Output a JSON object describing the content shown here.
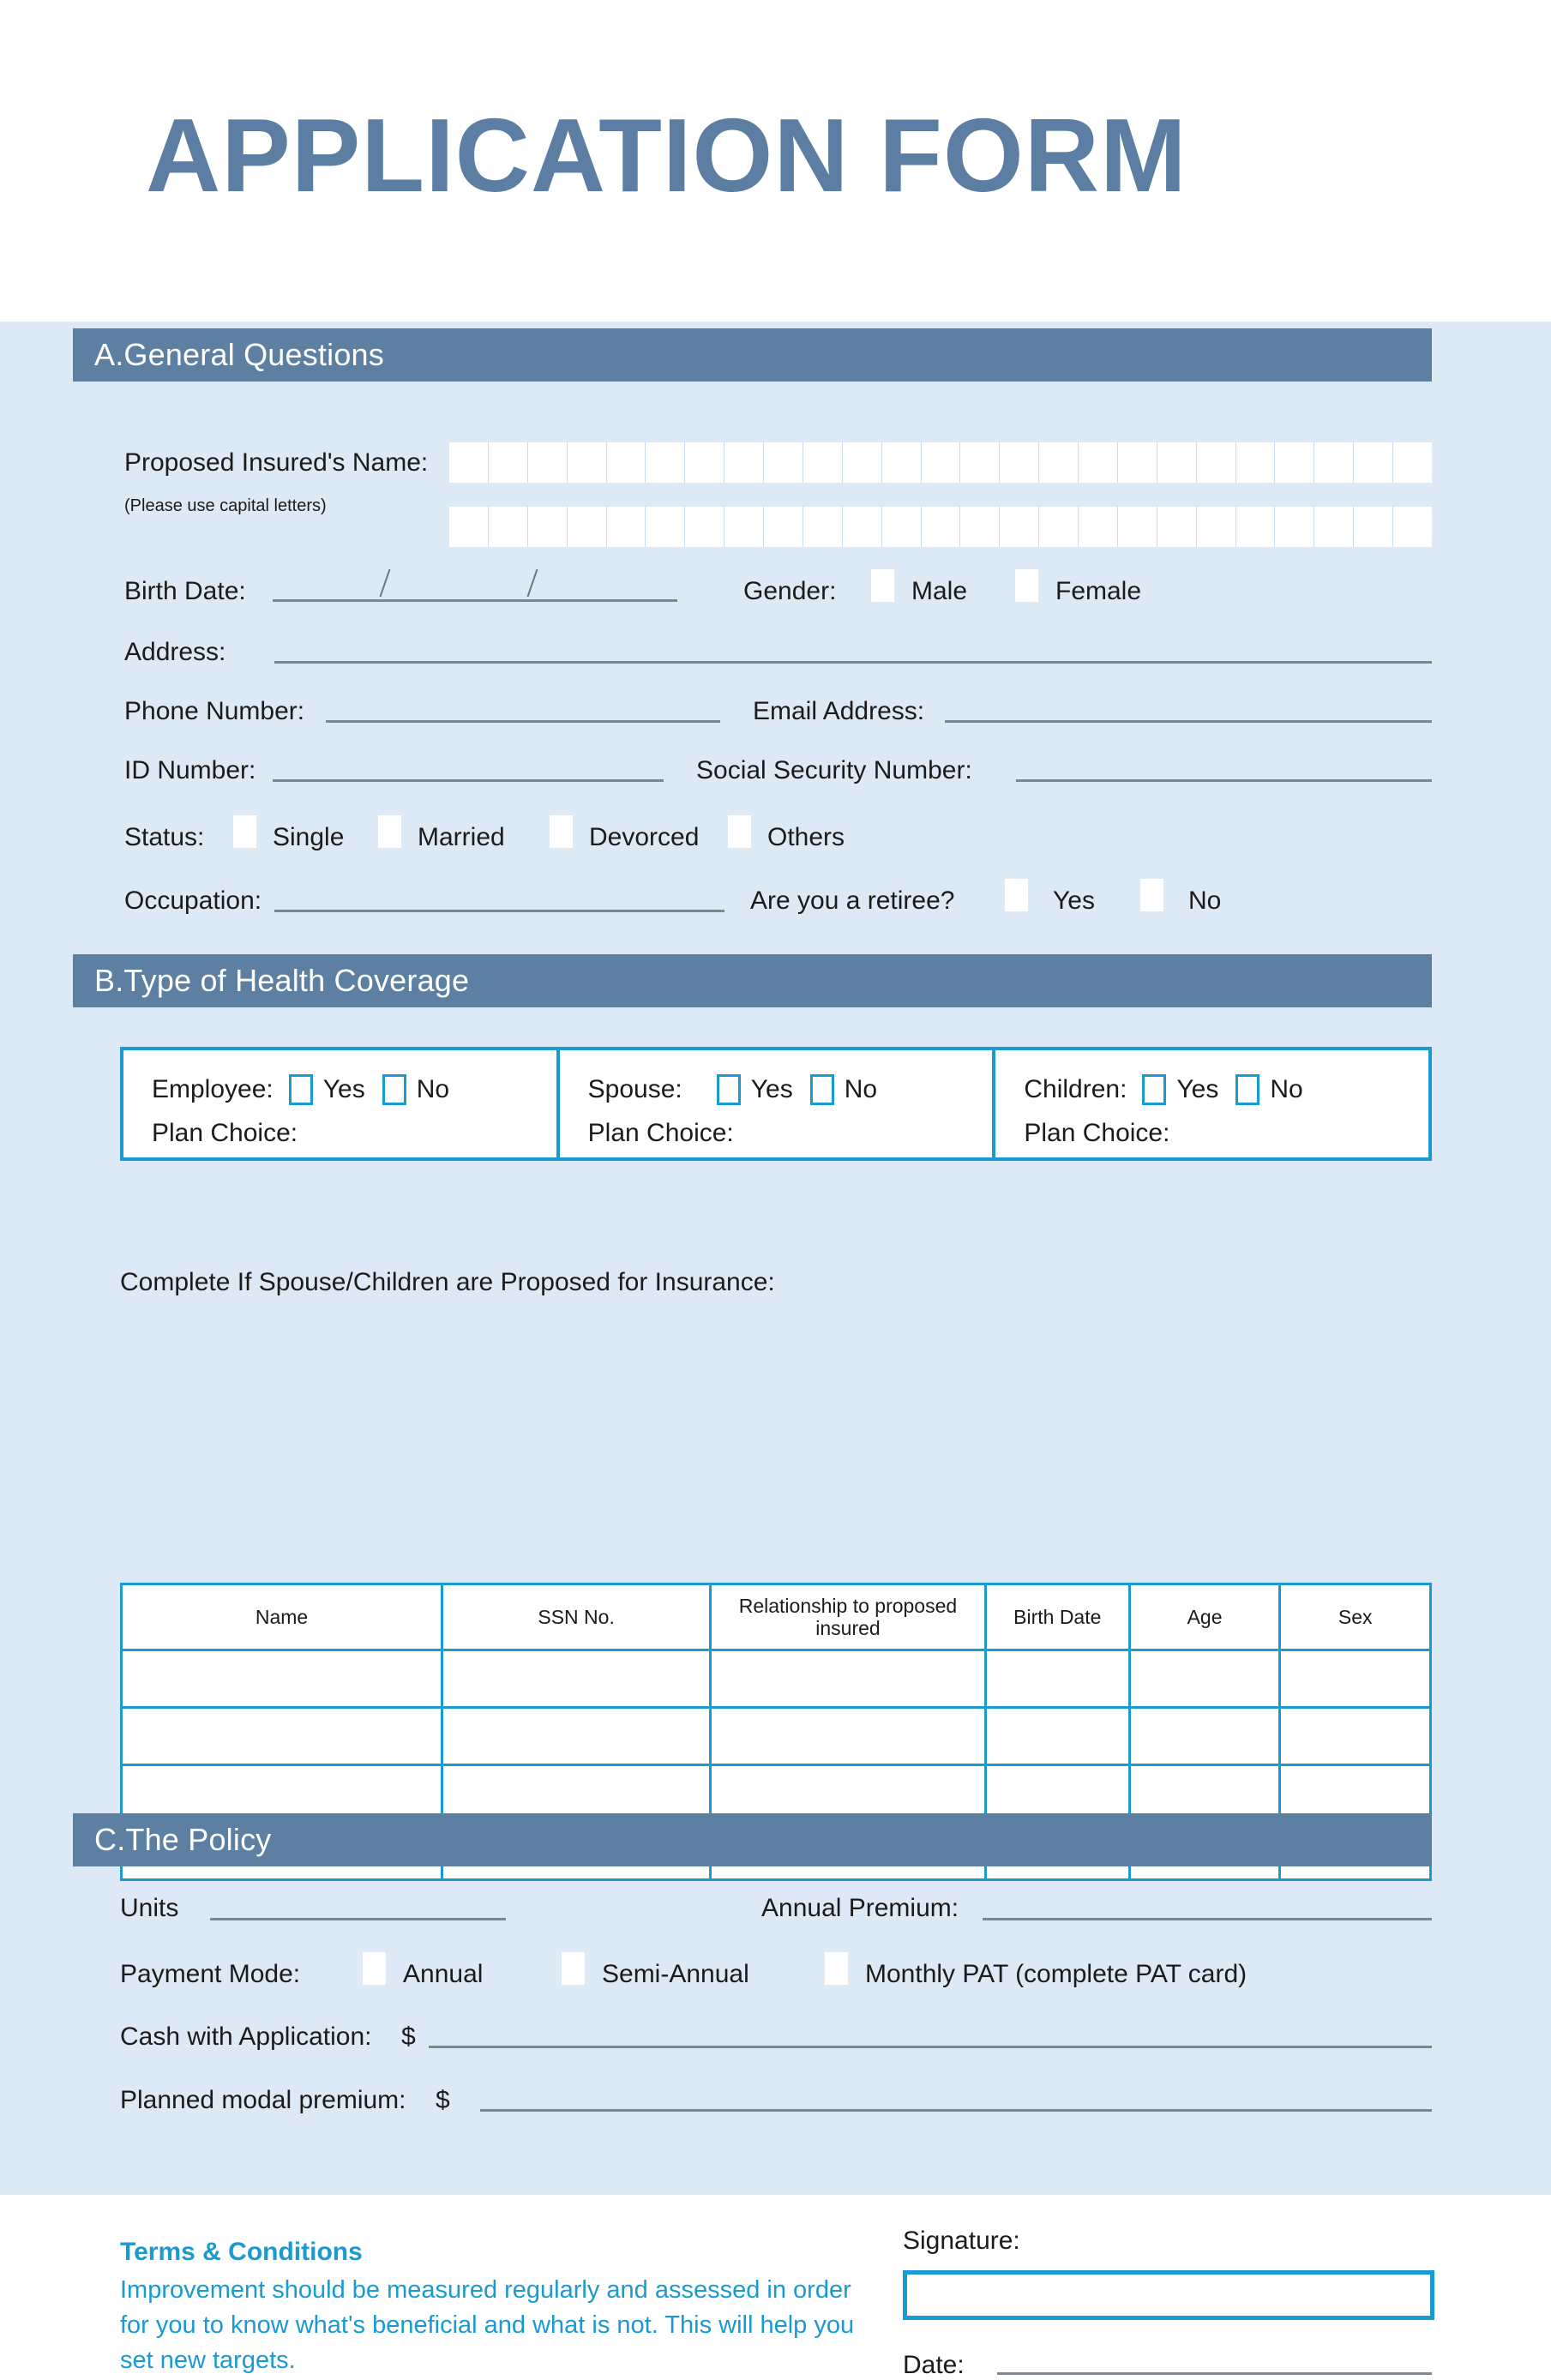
{
  "document": {
    "title": "APPLICATION FORM"
  },
  "colors": {
    "page_background": "#ffffff",
    "sheet_background": "#dde9f5",
    "section_bar": "#5d7fa2",
    "title_blue": "#5c7ea3",
    "accent_cyan": "#1b9ad1",
    "rule_gray": "#7b8792",
    "text": "#1b1b1b"
  },
  "sections": {
    "a": {
      "heading": "A.General Questions",
      "name_label": "Proposed Insured's Name:",
      "name_hint": "(Please use capital letters)",
      "name_cells_row1": 25,
      "name_cells_row2": 25,
      "birth_date_label": "Birth Date:",
      "gender_label": "Gender:",
      "gender_options": [
        "Male",
        "Female"
      ],
      "address_label": "Address:",
      "phone_label": "Phone Number:",
      "email_label": "Email Address:",
      "id_label": "ID Number:",
      "ssn_label": "Social Security  Number:",
      "status_label": "Status:",
      "status_options": [
        "Single",
        "Married",
        "Devorced",
        "Others"
      ],
      "occupation_label": "Occupation:",
      "retiree_label": "Are you a retiree?",
      "retiree_options": [
        "Yes",
        "No"
      ]
    },
    "b": {
      "heading": "B.Type of Health Coverage",
      "coverage": [
        {
          "name": "Employee:",
          "yes": "Yes",
          "no": "No",
          "plan_choice": "Plan Choice:"
        },
        {
          "name": "Spouse:",
          "yes": "Yes",
          "no": "No",
          "plan_choice": "Plan Choice:"
        },
        {
          "name": "Children:",
          "yes": "Yes",
          "no": "No",
          "plan_choice": "Plan Choice:"
        }
      ],
      "table_intro": "Complete If Spouse/Children are Proposed for Insurance:",
      "table": {
        "headers": [
          "Name",
          "SSN No.",
          "Relationship to proposed insured",
          "Birth Date",
          "Age",
          "Sex"
        ],
        "rows": [
          [
            "",
            "",
            "",
            "",
            "",
            ""
          ],
          [
            "",
            "",
            "",
            "",
            "",
            ""
          ],
          [
            "",
            "",
            "",
            "",
            "",
            ""
          ],
          [
            "",
            "",
            "",
            "",
            "",
            ""
          ]
        ]
      }
    },
    "c": {
      "heading": "C.The Policy",
      "units_label": "Units",
      "annual_premium_label": "Annual Premium:",
      "payment_mode_label": "Payment Mode:",
      "payment_mode_options": [
        "Annual",
        "Semi-Annual",
        "Monthly PAT (complete PAT card)"
      ],
      "cash_label": "Cash with Application:",
      "cash_currency": "$",
      "planned_label": "Planned modal premium:",
      "planned_currency": "$"
    }
  },
  "footer": {
    "terms_title": "Terms & Conditions",
    "terms_body": "Improvement should be measured regularly and assessed in order for you to know what's beneficial and what is not. This will help you set new targets.",
    "signature_label": "Signature:",
    "date_label": "Date:"
  }
}
